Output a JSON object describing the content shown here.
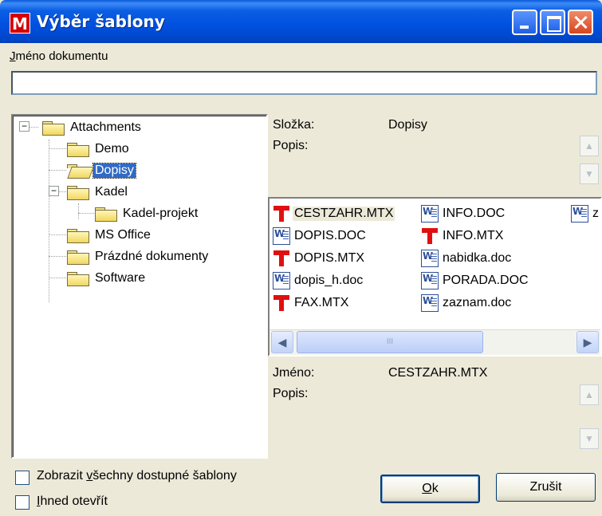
{
  "window": {
    "icon_letter": "M",
    "title": "Výběr šablony"
  },
  "document_name": {
    "label_prefix": "J",
    "label_rest": "méno dokumentu",
    "value": ""
  },
  "tree": {
    "items": [
      {
        "label": "Attachments",
        "level": 0,
        "expanded": true
      },
      {
        "label": "Demo",
        "level": 1
      },
      {
        "label": "Dopisy",
        "level": 1,
        "selected": true,
        "open": true
      },
      {
        "label": "Kadel",
        "level": 1,
        "expanded": true
      },
      {
        "label": "Kadel-projekt",
        "level": 2
      },
      {
        "label": "MS Office",
        "level": 1
      },
      {
        "label": "Prázdné dokumenty",
        "level": 1
      },
      {
        "label": "Software",
        "level": 1
      }
    ]
  },
  "folder_info": {
    "folder_label": "Složka:",
    "folder_value": "Dopisy",
    "description_label": "Popis:"
  },
  "files": {
    "columns": [
      [
        {
          "name": "CESTZAHR.MTX",
          "icon": "mtx-template-icon",
          "selected": true
        },
        {
          "name": "DOPIS.DOC",
          "icon": "word-doc-icon"
        },
        {
          "name": "DOPIS.MTX",
          "icon": "mtx-template-icon"
        },
        {
          "name": "dopis_h.doc",
          "icon": "word-doc-icon"
        },
        {
          "name": "FAX.MTX",
          "icon": "mtx-template-icon"
        }
      ],
      [
        {
          "name": "INFO.DOC",
          "icon": "word-doc-icon"
        },
        {
          "name": "INFO.MTX",
          "icon": "mtx-template-icon"
        },
        {
          "name": "nabidka.doc",
          "icon": "word-doc-icon"
        },
        {
          "name": "PORADA.DOC",
          "icon": "word-doc-icon"
        },
        {
          "name": "zaznam.doc",
          "icon": "word-doc-icon"
        }
      ],
      [
        {
          "name": "z",
          "icon": "word-doc-icon"
        }
      ]
    ],
    "scroll_grip": "III"
  },
  "file_info": {
    "name_label": "Jméno:",
    "name_value": "CESTZAHR.MTX",
    "description_label": "Popis:"
  },
  "options": {
    "show_all": {
      "prefix": "Zobrazit ",
      "underline": "v",
      "rest": "šechny dostupné šablony",
      "checked": false
    },
    "open_now": {
      "underline": "I",
      "rest": "hned otevřít",
      "checked": false
    }
  },
  "buttons": {
    "ok": {
      "underline": "O",
      "rest": "k"
    },
    "cancel": {
      "label": "Zrušit"
    }
  }
}
